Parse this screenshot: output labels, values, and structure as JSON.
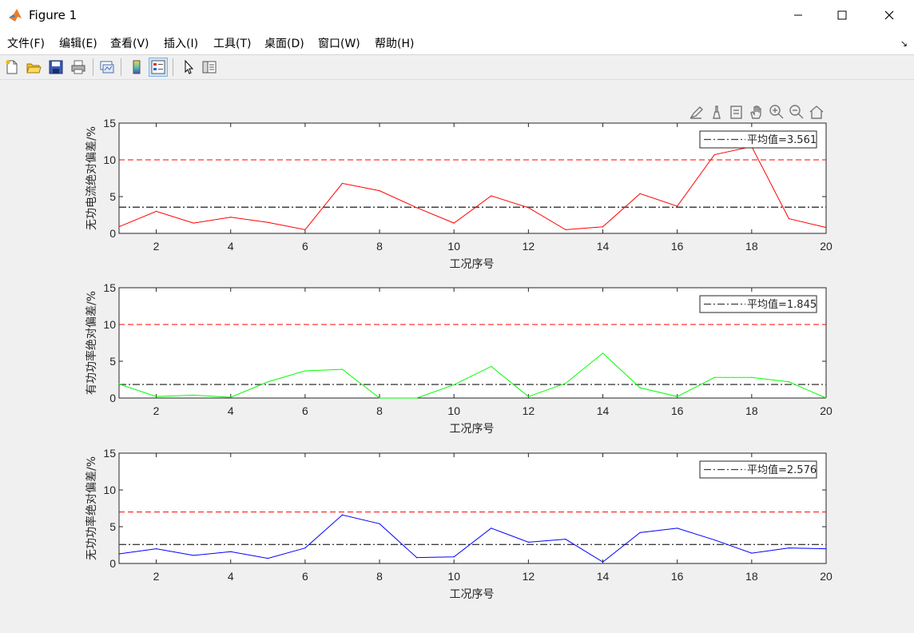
{
  "window": {
    "title": "Figure 1",
    "minimize_icon": "minimize-icon",
    "maximize_icon": "maximize-icon",
    "close_icon": "close-icon"
  },
  "menu": {
    "items": [
      "文件(F)",
      "编辑(E)",
      "查看(V)",
      "插入(I)",
      "工具(T)",
      "桌面(D)",
      "窗口(W)",
      "帮助(H)"
    ]
  },
  "toolbar": {
    "icons": [
      "new-figure-icon",
      "open-file-icon",
      "save-icon",
      "print-icon",
      "link-plot-icon",
      "colorbar-icon",
      "legend-icon",
      "edit-plot-arrow-icon",
      "property-inspector-icon"
    ],
    "active": "legend-icon"
  },
  "axes_toolbar": {
    "icons": [
      "brush-data-icon",
      "data-cursor-icon",
      "export-icon",
      "pan-icon",
      "zoom-in-icon",
      "zoom-out-icon",
      "home-icon"
    ]
  },
  "colors": {
    "series1": "#ff0000",
    "series2": "#00ff00",
    "series3": "#0000ff",
    "threshold": "#ff0000",
    "mean_line": "#404040"
  },
  "chart_data": [
    {
      "type": "line",
      "x": [
        1,
        2,
        3,
        4,
        5,
        6,
        7,
        8,
        9,
        10,
        11,
        12,
        13,
        14,
        15,
        16,
        17,
        18,
        19,
        20
      ],
      "values": [
        0.9,
        3.0,
        1.4,
        2.2,
        1.5,
        0.5,
        6.8,
        5.8,
        3.5,
        1.4,
        5.1,
        3.5,
        0.5,
        0.9,
        5.4,
        3.7,
        10.7,
        11.8,
        2.0,
        0.8
      ],
      "threshold": 10,
      "mean": 3.561,
      "legend_label": "平均值=3.561",
      "xlabel": "工况序号",
      "ylabel": "无功电流绝对偏差/%",
      "xlim": [
        1,
        20
      ],
      "ylim": [
        0,
        15
      ],
      "xticks": [
        2,
        4,
        6,
        8,
        10,
        12,
        14,
        16,
        18,
        20
      ],
      "yticks": [
        0,
        5,
        10,
        15
      ],
      "color": "#ff0000",
      "legend_position": "top-right"
    },
    {
      "type": "line",
      "x": [
        1,
        2,
        3,
        4,
        5,
        6,
        7,
        8,
        9,
        10,
        11,
        12,
        13,
        14,
        15,
        16,
        17,
        18,
        19,
        20
      ],
      "values": [
        1.9,
        0.2,
        0.4,
        0.1,
        2.2,
        3.7,
        3.9,
        0.0,
        0.0,
        1.8,
        4.3,
        0.2,
        2.0,
        6.1,
        1.4,
        0.2,
        2.8,
        2.8,
        2.2,
        0.0
      ],
      "threshold": 10,
      "mean": 1.845,
      "legend_label": "平均值=1.845",
      "xlabel": "工况序号",
      "ylabel": "有功功率绝对偏差/%",
      "xlim": [
        1,
        20
      ],
      "ylim": [
        0,
        15
      ],
      "xticks": [
        2,
        4,
        6,
        8,
        10,
        12,
        14,
        16,
        18,
        20
      ],
      "yticks": [
        0,
        5,
        10,
        15
      ],
      "color": "#00ff00",
      "legend_position": "top-right"
    },
    {
      "type": "line",
      "x": [
        1,
        2,
        3,
        4,
        5,
        6,
        7,
        8,
        9,
        10,
        11,
        12,
        13,
        14,
        15,
        16,
        17,
        18,
        19,
        20
      ],
      "values": [
        1.3,
        2.0,
        1.1,
        1.6,
        0.7,
        2.1,
        6.6,
        5.4,
        0.8,
        0.9,
        4.8,
        2.9,
        3.3,
        0.2,
        4.2,
        4.8,
        3.2,
        1.4,
        2.1,
        2.0
      ],
      "threshold": 7,
      "mean": 2.576,
      "legend_label": "平均值=2.576",
      "xlabel": "工况序号",
      "ylabel": "无功功率绝对偏差/%",
      "xlim": [
        1,
        20
      ],
      "ylim": [
        0,
        15
      ],
      "xticks": [
        2,
        4,
        6,
        8,
        10,
        12,
        14,
        16,
        18,
        20
      ],
      "yticks": [
        0,
        5,
        10,
        15
      ],
      "color": "#0000ff",
      "legend_position": "top-right"
    }
  ]
}
